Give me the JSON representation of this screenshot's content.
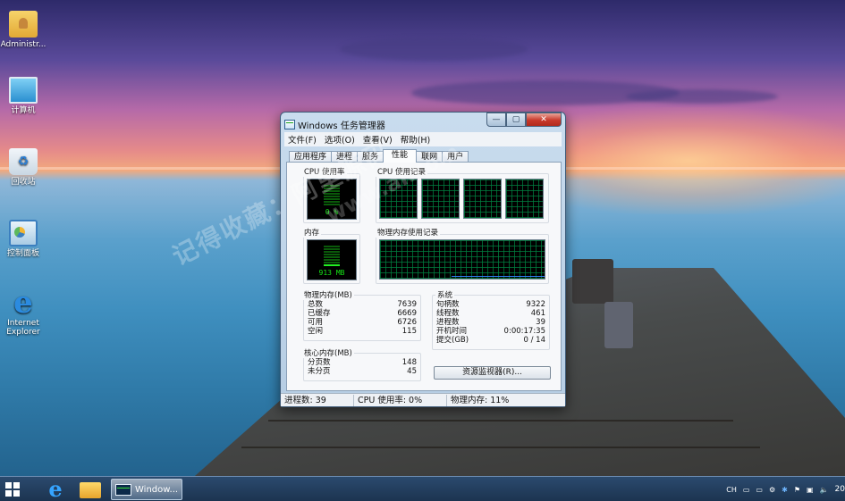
{
  "desktop": {
    "icons": [
      {
        "label": "Administr..."
      },
      {
        "label": "计算机"
      },
      {
        "label": "回收站"
      },
      {
        "label": "控制面板"
      },
      {
        "label": "Internet Explorer"
      }
    ]
  },
  "watermark": {
    "line1": "记得收藏：阿里源码",
    "line2": "www.al.com"
  },
  "window": {
    "title": "Windows 任务管理器",
    "min_glyph": "—",
    "max_glyph": "▢",
    "close_glyph": "✕",
    "menu": [
      "文件(F)",
      "选项(O)",
      "查看(V)",
      "帮助(H)"
    ],
    "tabs": [
      "应用程序",
      "进程",
      "服务",
      "性能",
      "联网",
      "用户"
    ],
    "active_tab": "性能",
    "perf": {
      "cpu_usage_label": "CPU 使用率",
      "cpu_history_label": "CPU 使用记录",
      "cpu_value": "0 %",
      "cpu_level": 0.0,
      "mem_label": "内存",
      "mem_history_label": "物理内存使用记录",
      "mem_value": "913 MB",
      "mem_level": 0.12,
      "physical": {
        "title": "物理内存(MB)",
        "rows": [
          {
            "k": "总数",
            "v": "7639"
          },
          {
            "k": "已缓存",
            "v": "6669"
          },
          {
            "k": "可用",
            "v": "6726"
          },
          {
            "k": "空闲",
            "v": "115"
          }
        ]
      },
      "kernel": {
        "title": "核心内存(MB)",
        "rows": [
          {
            "k": "分页数",
            "v": "148"
          },
          {
            "k": "未分页",
            "v": "45"
          }
        ]
      },
      "system": {
        "title": "系统",
        "rows": [
          {
            "k": "句柄数",
            "v": "9322"
          },
          {
            "k": "线程数",
            "v": "461"
          },
          {
            "k": "进程数",
            "v": "39"
          },
          {
            "k": "开机时间",
            "v": "0:00:17:35"
          },
          {
            "k": "提交(GB)",
            "v": "0 / 14"
          }
        ]
      },
      "resmon_button": "资源监视器(R)..."
    },
    "status": {
      "processes": "进程数: 39",
      "cpu": "CPU 使用率: 0%",
      "memory": "物理内存: 11%"
    }
  },
  "taskbar": {
    "task_label": "Window...",
    "tray_lang": "CH",
    "clock": "20"
  }
}
